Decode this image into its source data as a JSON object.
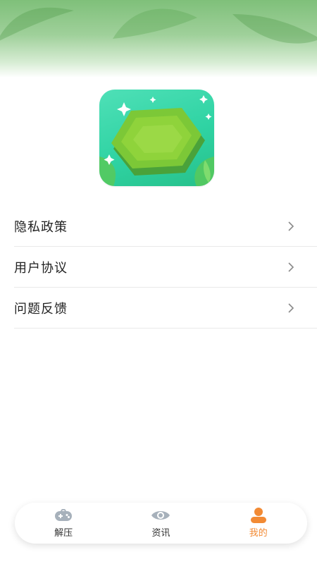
{
  "menu": {
    "items": [
      {
        "label": "隐私政策"
      },
      {
        "label": "用户协议"
      },
      {
        "label": "问题反馈"
      }
    ]
  },
  "tabbar": {
    "tabs": [
      {
        "label": "解压",
        "icon": "gamepad-icon"
      },
      {
        "label": "资讯",
        "icon": "eye-icon"
      },
      {
        "label": "我的",
        "icon": "user-icon"
      }
    ],
    "active_color": "#f28a34",
    "inactive_color": "#a7b1bb"
  },
  "colors": {
    "banner": "#8cc887",
    "icon_bg": "#2fd3a3",
    "hexagon": "#8fd33b"
  }
}
